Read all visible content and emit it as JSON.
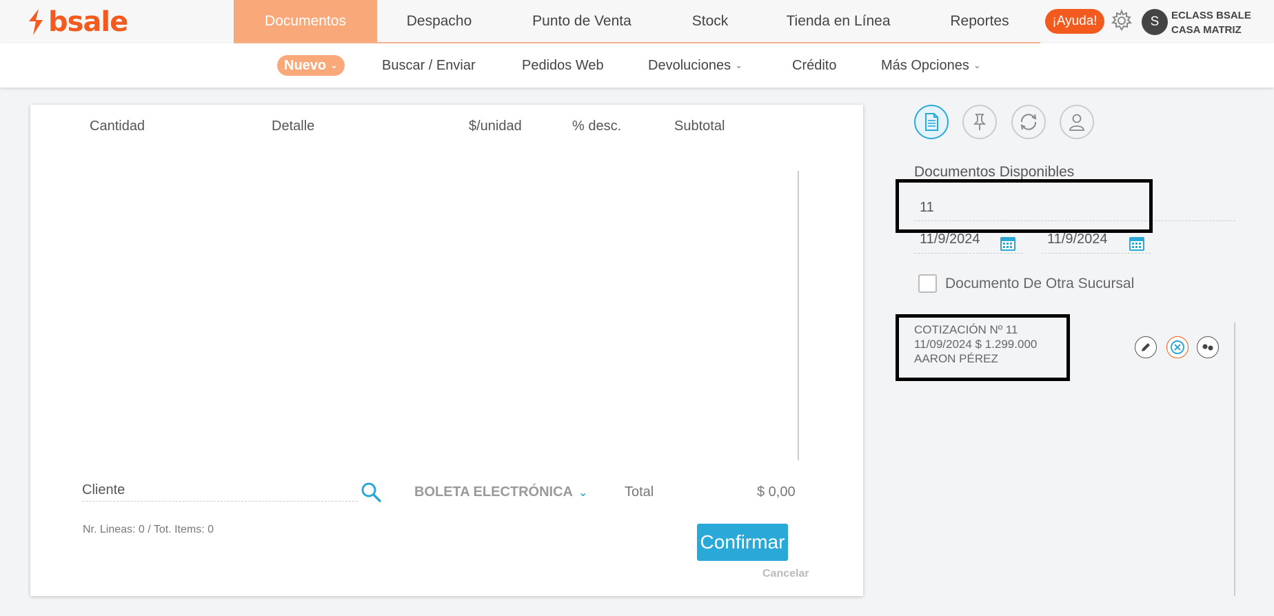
{
  "brand": {
    "name": "bsale",
    "color": "#f35a1e"
  },
  "nav": {
    "items": [
      {
        "label": "Documentos",
        "active": true
      },
      {
        "label": "Despacho"
      },
      {
        "label": "Punto de Venta"
      },
      {
        "label": "Stock"
      },
      {
        "label": "Tienda en Línea"
      },
      {
        "label": "Reportes"
      }
    ]
  },
  "header": {
    "help_label": "¡Ayuda!",
    "avatar_initial": "S",
    "user_name": "ECLASS BSALE",
    "branch": "CASA MATRIZ"
  },
  "subnav": {
    "items": [
      {
        "label": "Nuevo",
        "has_dropdown": true,
        "active": true
      },
      {
        "label": "Buscar / Enviar"
      },
      {
        "label": "Pedidos Web"
      },
      {
        "label": "Devoluciones",
        "has_dropdown": true
      },
      {
        "label": "Crédito"
      },
      {
        "label": "Más Opciones",
        "has_dropdown": true
      }
    ]
  },
  "table": {
    "columns": [
      "Cantidad",
      "Detalle",
      "$/unidad",
      "% desc.",
      "Subtotal"
    ]
  },
  "footer": {
    "client_placeholder": "Cliente",
    "document_type": "BOLETA ELECTRÓNICA",
    "total_label": "Total",
    "total_value": "$ 0,00",
    "lines_info": "Nr. Lineas: 0 / Tot. Items: 0",
    "confirm_label": "Confirmar",
    "cancel_label": "Cancelar"
  },
  "panel": {
    "title": "Documentos Disponibles",
    "number": "11",
    "date_from": "11/9/2024",
    "date_to": "11/9/2024",
    "other_branch_label": "Documento De Otra Sucursal",
    "quote": {
      "line1": "COTIZACIÓN Nº 11",
      "line2": "11/09/2024 $ 1.299.000",
      "line3": "AARON PÉREZ"
    }
  },
  "colors": {
    "accent_orange": "#f9a87a",
    "brand_orange": "#f35a1e",
    "accent_blue": "#2aa9d8"
  },
  "icons": [
    "document-icon",
    "pin-icon",
    "refresh-icon",
    "user-icon",
    "gear-icon",
    "search-icon",
    "calendar-icon",
    "edit-icon",
    "cancel-icon",
    "percent-icon"
  ]
}
